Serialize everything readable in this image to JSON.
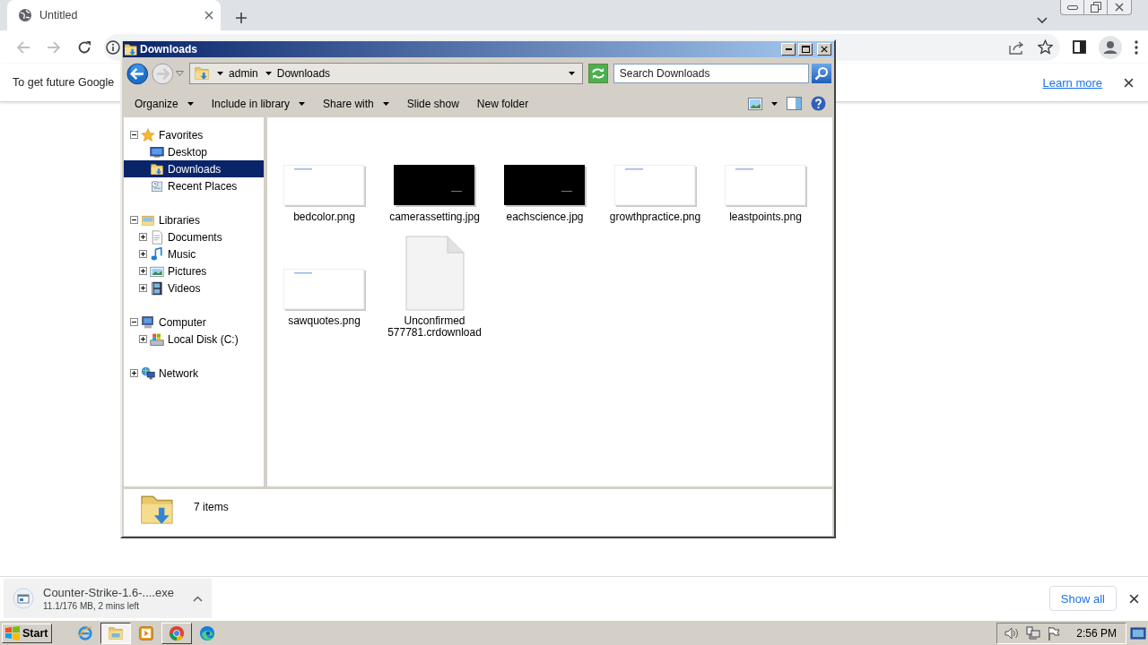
{
  "browser": {
    "tab": {
      "title": "Untitled"
    },
    "infobar": {
      "message": "To get future Google",
      "link": "Learn more"
    },
    "downloads_bar": {
      "item": {
        "filename": "Counter-Strike-1.6-....exe",
        "status": "11.1/176 MB, 2 mins left"
      },
      "show_all": "Show all"
    }
  },
  "explorer": {
    "title": "Downloads",
    "breadcrumb": [
      "admin",
      "Downloads"
    ],
    "search": {
      "placeholder": "Search Downloads"
    },
    "toolbar": [
      {
        "label": "Organize",
        "dropdown": true
      },
      {
        "label": "Include in library",
        "dropdown": true
      },
      {
        "label": "Share with",
        "dropdown": true
      },
      {
        "label": "Slide show",
        "dropdown": false
      },
      {
        "label": "New folder",
        "dropdown": false
      }
    ],
    "nav": [
      {
        "label": "Favorites",
        "kind": "favorites",
        "expanded": true,
        "selected": false,
        "children": [
          {
            "label": "Desktop",
            "kind": "desktop",
            "selected": false
          },
          {
            "label": "Downloads",
            "kind": "downloads",
            "selected": true
          },
          {
            "label": "Recent Places",
            "kind": "recent",
            "selected": false
          }
        ]
      },
      {
        "label": "Libraries",
        "kind": "libraries",
        "expanded": true,
        "selected": false,
        "children": [
          {
            "label": "Documents",
            "kind": "documents",
            "expanded": false,
            "selected": false
          },
          {
            "label": "Music",
            "kind": "music",
            "expanded": false,
            "selected": false
          },
          {
            "label": "Pictures",
            "kind": "pictures",
            "expanded": false,
            "selected": false
          },
          {
            "label": "Videos",
            "kind": "videos",
            "expanded": false,
            "selected": false
          }
        ]
      },
      {
        "label": "Computer",
        "kind": "computer",
        "expanded": true,
        "selected": false,
        "children": [
          {
            "label": "Local Disk (C:)",
            "kind": "disk",
            "expanded": false,
            "selected": false
          }
        ]
      },
      {
        "label": "Network",
        "kind": "network",
        "expanded": false,
        "selected": false
      }
    ],
    "files": [
      {
        "name": "bedcolor.png",
        "kind": "light"
      },
      {
        "name": "camerassetting.jpg",
        "kind": "dark"
      },
      {
        "name": "eachscience.jpg",
        "kind": "dark"
      },
      {
        "name": "growthpractice.png",
        "kind": "light"
      },
      {
        "name": "leastpoints.png",
        "kind": "light"
      },
      {
        "name": "sawquotes.png",
        "kind": "light"
      },
      {
        "name": "Unconfirmed 577781.crdownload",
        "kind": "file"
      }
    ],
    "status": "7 items"
  },
  "taskbar": {
    "start": "Start",
    "apps": [
      {
        "kind": "ie",
        "open": false,
        "selected": false
      },
      {
        "kind": "explorer",
        "open": true,
        "selected": true
      },
      {
        "kind": "media",
        "open": false,
        "selected": false
      },
      {
        "kind": "chrome",
        "open": true,
        "selected": false
      },
      {
        "kind": "edge",
        "open": false,
        "selected": false
      }
    ],
    "clock": "2:56 PM"
  }
}
